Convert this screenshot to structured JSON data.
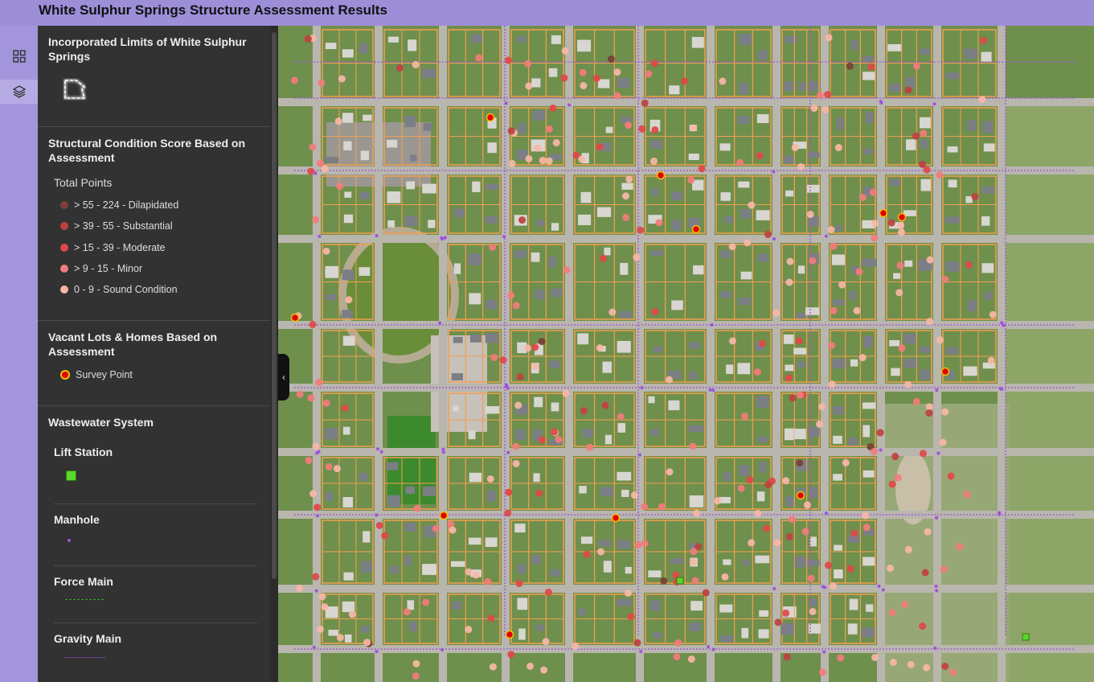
{
  "header": {
    "title": "White Sulphur Springs Structure Assessment Results"
  },
  "rail": {
    "items": [
      {
        "icon": "grid-icon"
      },
      {
        "icon": "layers-icon"
      }
    ]
  },
  "legend": {
    "incorporated": {
      "title": "Incorporated Limits of White Sulphur Springs"
    },
    "structural": {
      "title": "Structural Condition Score Based on Assessment",
      "subtitle": "Total Points",
      "classes": [
        {
          "label": "> 55 - 224 - Dilapidated",
          "color": "#7a3f36"
        },
        {
          "label": "> 39 - 55 - Substantial",
          "color": "#c04040"
        },
        {
          "label": "> 15 - 39 - Moderate",
          "color": "#e04848"
        },
        {
          "label": "> 9 - 15 - Minor",
          "color": "#f27c7c"
        },
        {
          "label": "0 - 9 - Sound Condition",
          "color": "#f7b7a7"
        }
      ]
    },
    "vacant": {
      "title": "Vacant Lots & Homes Based on Assessment",
      "item": "Survey Point"
    },
    "wastewater": {
      "title": "Wastewater System",
      "lift_station": "Lift Station",
      "manhole": "Manhole",
      "force_main": "Force Main",
      "gravity_main": "Gravity Main"
    }
  },
  "colors": {
    "parcel": "#f0a050",
    "sewer": "#a050e0",
    "lift_station": "#5ad82a",
    "survey_point_fill": "#e00000",
    "survey_point_ring": "#f2c200"
  }
}
